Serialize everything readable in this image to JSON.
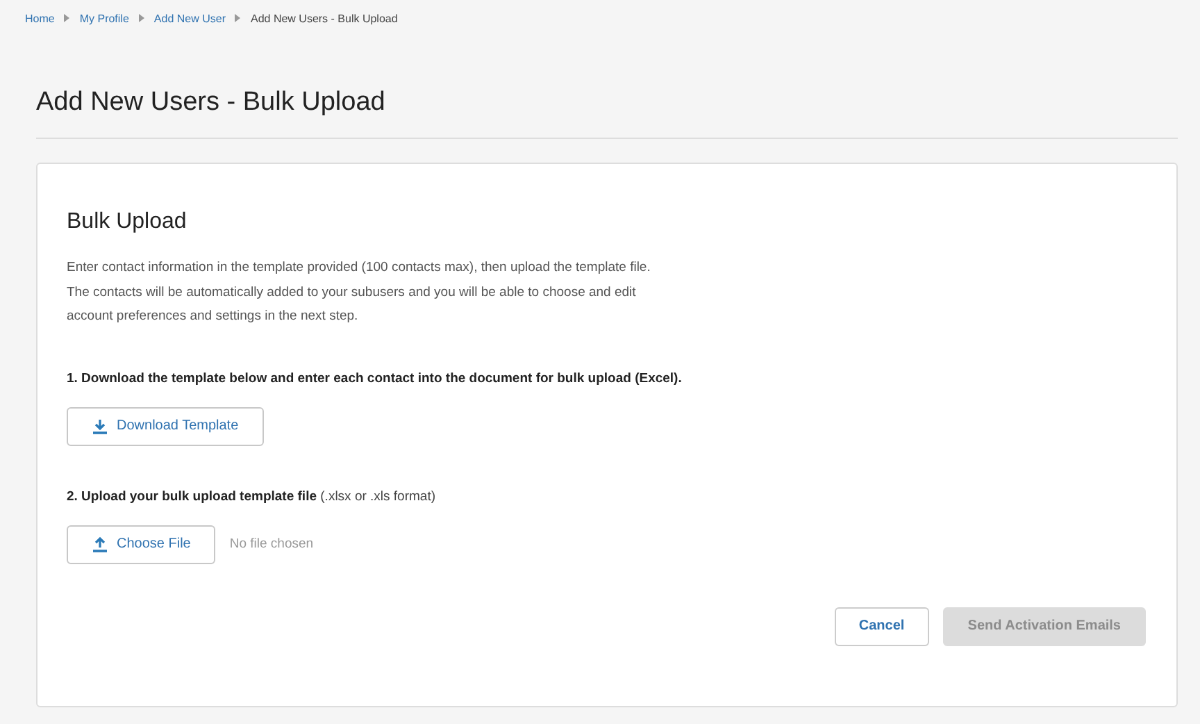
{
  "breadcrumb": [
    {
      "label": "Home",
      "current": false
    },
    {
      "label": "My Profile",
      "current": false
    },
    {
      "label": "Add New User",
      "current": false
    },
    {
      "label": "Add New Users - Bulk Upload",
      "current": true
    }
  ],
  "page_title": "Add New Users - Bulk Upload",
  "card": {
    "title": "Bulk Upload",
    "intro": [
      "Enter contact information in the template provided (100 contacts max), then upload the template file.",
      "The contacts will be automatically added to your subusers and you will be able to choose and edit",
      "account preferences and settings in the next step."
    ],
    "steps": [
      {
        "label": "**1. Download the template below and enter each contact into the document for bulk upload (Excel).**",
        "button": {
          "label": "Download Template",
          "kind": "download"
        }
      },
      {
        "label": "**2. Upload your bulk upload template file** (.xlsx or .xls format)",
        "button": {
          "label": "Choose File",
          "kind": "upload"
        },
        "file_status": "No file chosen"
      }
    ],
    "actions": [
      {
        "label": "Cancel",
        "kind": "secondary",
        "disabled": false
      },
      {
        "label": "Send Activation Emails",
        "kind": "primary",
        "disabled": true
      }
    ]
  }
}
